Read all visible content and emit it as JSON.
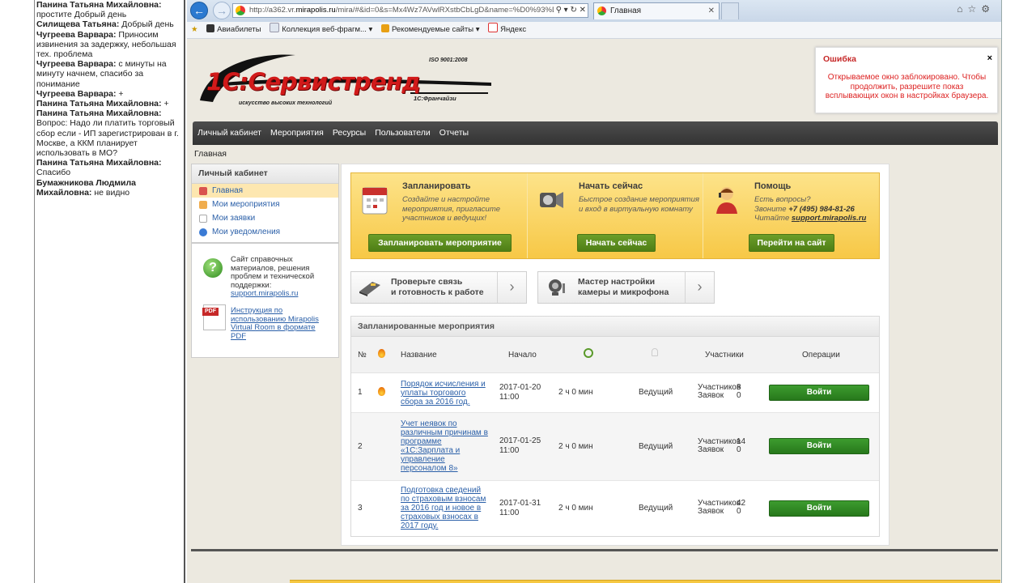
{
  "chat": {
    "messages": [
      {
        "author": "Панина Татьяна Михайловна:",
        "text": "простите Добрый день"
      },
      {
        "author": "Силищева Татьяна:",
        "text": "Добрый день"
      },
      {
        "author": "Чугреева Варвара:",
        "text": "Приносим извинения за задержку, небольшая тех. проблема"
      },
      {
        "author": "Чугреева Варвара:",
        "text": "с минуты на минуту начнем, спасибо за понимание"
      },
      {
        "author": "Чугреева Варвара:",
        "text": "+"
      },
      {
        "author": "Панина Татьяна Михайловна:",
        "text": "+"
      },
      {
        "author": "Панина Татьяна Михайловна:",
        "text": "Вопрос: Надо ли платить торговый сбор если - ИП зарегистрирован в г. Москве, а ККМ планирует использовать в МО?"
      },
      {
        "author": "Панина Татьяна Михайловна:",
        "text": "Спасибо"
      },
      {
        "author": "Бумажникова Людмила Михайловна:",
        "text": "не видно"
      }
    ]
  },
  "browser": {
    "url_prefix": "http://a362.vr.",
    "url_host": "mirapolis.ru",
    "url_rest": "/mira/#&id=0&s=Mx4Wz7AVwlRXstbCbLgD&name=%D0%93%D",
    "tab_title": "Главная",
    "favorites": [
      "Авиабилеты",
      "Коллекция веб-фрагм...",
      "Рекомендуемые сайты",
      "Яндекс"
    ]
  },
  "logo": {
    "name": "1С:Сервистренд",
    "iso": "ISO 9001:2008",
    "slogan": "искусство высоких технологий",
    "franchise": "1С:Франчайзи"
  },
  "popup": {
    "title": "Ошибка",
    "close": "×",
    "message": "Открываемое окно заблокировано. Чтобы продолжить, разрешите показ всплывающих окон в настройках браузера."
  },
  "nav": [
    "Личный кабинет",
    "Мероприятия",
    "Ресурсы",
    "Пользователи",
    "Отчеты"
  ],
  "breadcrumb": "Главная",
  "sidebar": {
    "title": "Личный кабинет",
    "items": [
      "Главная",
      "Мои мероприятия",
      "Мои заявки",
      "Мои уведомления"
    ],
    "help_text": "Сайт справочных материалов, решения проблем и технической поддержки:",
    "help_link": "support.mirapolis.ru",
    "pdf_label": "PDF",
    "pdf_link": "Инструкция по использованию Mirapolis Virtual Room в формате PDF"
  },
  "promo": [
    {
      "title": "Запланировать",
      "desc": "Создайте и настройте мероприятия, пригласите участников и ведущих!",
      "button": "Запланировать мероприятие"
    },
    {
      "title": "Начать сейчас",
      "desc": "Быстрое создание мероприятия и вход в виртуальную комнату",
      "button": "Начать сейчас"
    },
    {
      "title": "Помощь",
      "desc1": "Есть вопросы?",
      "desc2": "Звоните ",
      "phone": "+7 (495) 984-81-26",
      "desc3": "Читайте ",
      "link": "support.mirapolis.ru",
      "button": "Перейти на сайт"
    }
  ],
  "tools": [
    {
      "line1": "Проверьте связь",
      "line2": "и готовность к работе",
      "arrow": "›"
    },
    {
      "line1": "Мастер настройки",
      "line2": "камеры и микрофона",
      "arrow": "›"
    }
  ],
  "schedule": {
    "title": "Запланированные мероприятия",
    "headers": {
      "num": "№",
      "name": "Название",
      "start": "Начало",
      "participants": "Участники",
      "ops": "Операции"
    },
    "participants_label": "Участников",
    "requests_label": "Заявок",
    "enter": "Войти",
    "rows": [
      {
        "num": "1",
        "hot": true,
        "name": "Порядок исчисления и уплаты торгового сбора за 2016 год.",
        "date": "2017-01-20",
        "time": "11:00",
        "duration": "2 ч 0 мин",
        "role": "Ведущий",
        "participants": "8",
        "requests": "0"
      },
      {
        "num": "2",
        "hot": false,
        "name": "Учет неявок по различным причинам в программе «1С:Зарплата и управление персоналом 8»",
        "date": "2017-01-25",
        "time": "11:00",
        "duration": "2 ч 0 мин",
        "role": "Ведущий",
        "participants": "14",
        "requests": "0"
      },
      {
        "num": "3",
        "hot": false,
        "name": "Подготовка сведений по страховым взносам за 2016 год и новое в страховых взносах в 2017 году.",
        "date": "2017-01-31",
        "time": "11:00",
        "duration": "2 ч 0 мин",
        "role": "Ведущий",
        "participants": "42",
        "requests": "0"
      }
    ]
  },
  "colors": {
    "brand_red": "#d11a1a",
    "nav_dark": "#3a3a3a",
    "promo_yellow": "#f7c846",
    "button_green": "#3d9c2f",
    "link_blue": "#2a5fa8"
  }
}
